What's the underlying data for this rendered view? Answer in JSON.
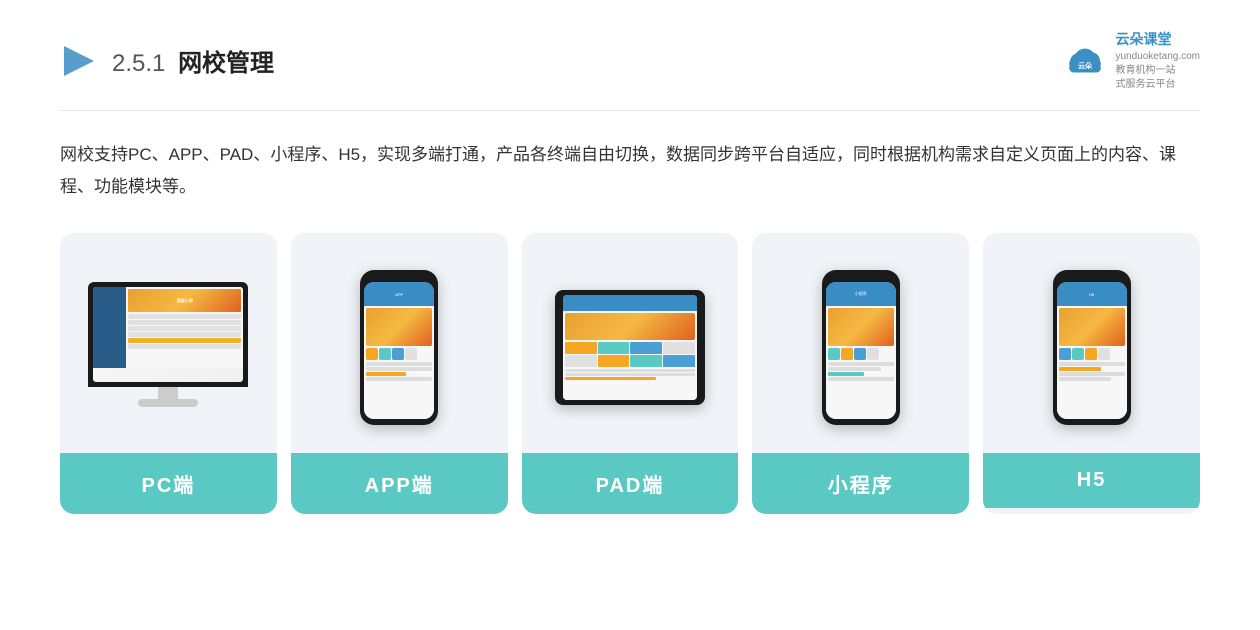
{
  "header": {
    "section_number": "2.5.1",
    "title": "网校管理",
    "logo_alt": "云朵课堂",
    "logo_domain": "yunduoketang.com",
    "logo_tagline1": "教育机构一站",
    "logo_tagline2": "式服务云平台"
  },
  "description": {
    "text": "网校支持PC、APP、PAD、小程序、H5，实现多端打通，产品各终端自由切换，数据同步跨平台自适应，同时根据机构需求自定义页面上的内容、课程、功能模块等。"
  },
  "cards": [
    {
      "id": "pc",
      "label": "PC端"
    },
    {
      "id": "app",
      "label": "APP端"
    },
    {
      "id": "pad",
      "label": "PAD端"
    },
    {
      "id": "miniprogram",
      "label": "小程序"
    },
    {
      "id": "h5",
      "label": "H5"
    }
  ],
  "colors": {
    "card_label_bg": "#5bc9c3",
    "card_bg": "#eef2f6",
    "accent_orange": "#e8a030",
    "accent_blue": "#3a8dc4"
  }
}
